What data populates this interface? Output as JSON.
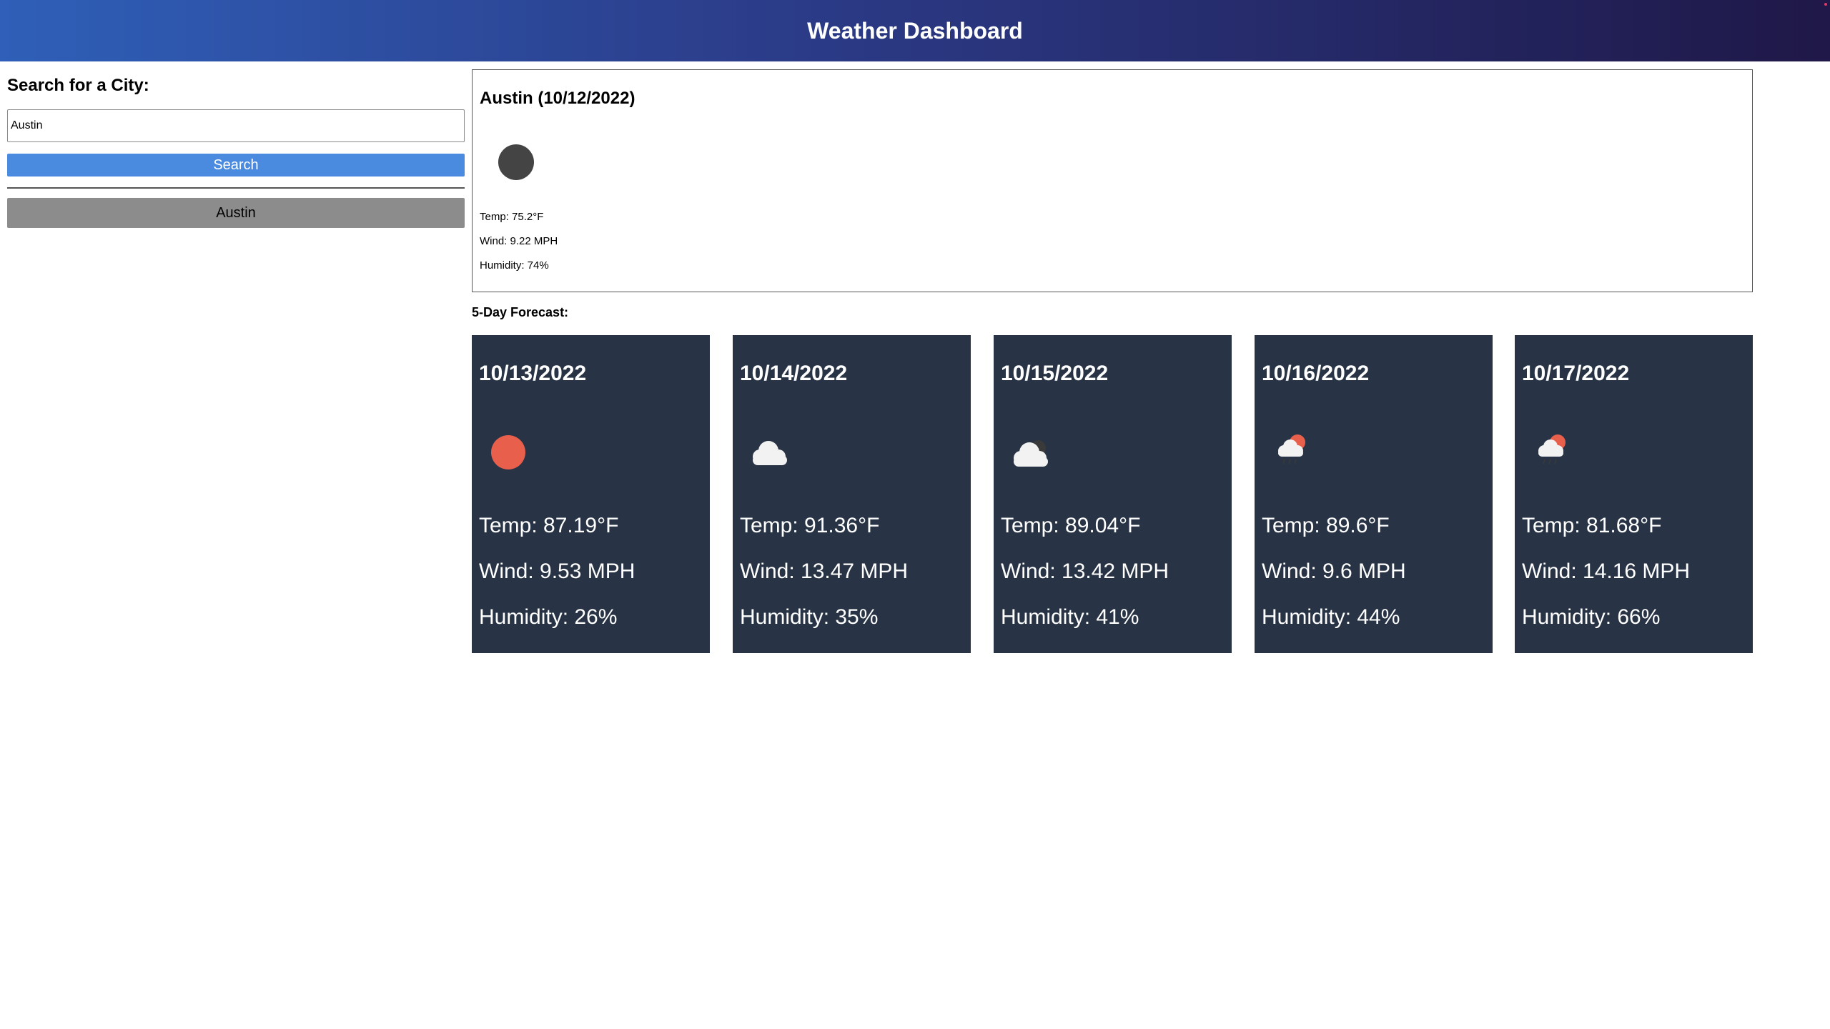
{
  "header": {
    "title": "Weather Dashboard"
  },
  "sidebar": {
    "heading": "Search for a City:",
    "search_value": "Austin",
    "search_button_label": "Search",
    "history": [
      {
        "label": "Austin"
      }
    ]
  },
  "current": {
    "title": "Austin (10/12/2022)",
    "icon": "moon-icon",
    "temp": "Temp: 75.2°F",
    "wind": "Wind: 9.22 MPH",
    "humidity": "Humidity: 74%"
  },
  "forecast": {
    "heading": "5-Day Forecast:",
    "days": [
      {
        "date": "10/13/2022",
        "icon": "sun-icon",
        "temp": "Temp: 87.19°F",
        "wind": "Wind: 9.53 MPH",
        "humidity": "Humidity: 26%"
      },
      {
        "date": "10/14/2022",
        "icon": "cloud-icon",
        "temp": "Temp: 91.36°F",
        "wind": "Wind: 13.47 MPH",
        "humidity": "Humidity: 35%"
      },
      {
        "date": "10/15/2022",
        "icon": "cloud-night-icon",
        "temp": "Temp: 89.04°F",
        "wind": "Wind: 13.42 MPH",
        "humidity": "Humidity: 41%"
      },
      {
        "date": "10/16/2022",
        "icon": "rain-sun-icon",
        "temp": "Temp: 89.6°F",
        "wind": "Wind: 9.6 MPH",
        "humidity": "Humidity: 44%"
      },
      {
        "date": "10/17/2022",
        "icon": "rain-sun-icon",
        "temp": "Temp: 81.68°F",
        "wind": "Wind: 14.16 MPH",
        "humidity": "Humidity: 66%"
      }
    ]
  },
  "colors": {
    "header_gradient_start": "#2f5fb8",
    "header_gradient_end": "#1f1848",
    "search_button": "#4a8be0",
    "history_button": "#8c8c8c",
    "card_background": "#283445",
    "sun": "#e8604c",
    "moon": "#444444",
    "cloud": "#f2f2f2"
  }
}
